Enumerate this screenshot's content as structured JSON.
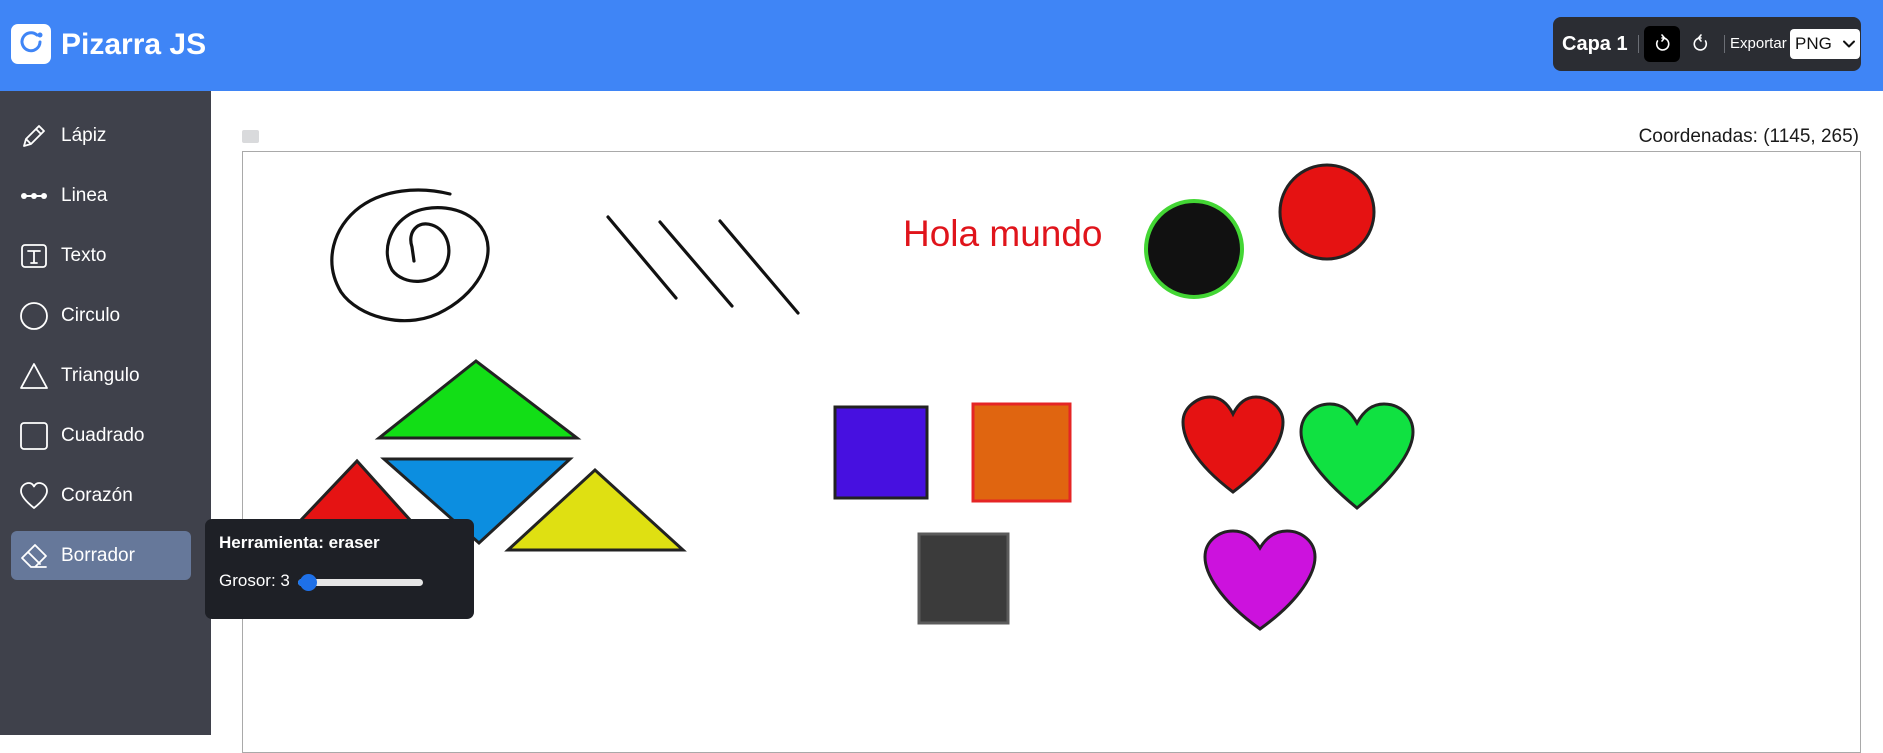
{
  "app": {
    "title": "Pizarra JS"
  },
  "toolbar": {
    "layer_label": "Capa 1",
    "undo_icon": "undo-icon",
    "redo_icon": "redo-icon",
    "export_label": "Exportar",
    "export_format": "PNG"
  },
  "sidebar": {
    "items": [
      {
        "label": "Lápiz",
        "icon": "pencil-icon"
      },
      {
        "label": "Linea",
        "icon": "line-icon"
      },
      {
        "label": "Texto",
        "icon": "text-icon"
      },
      {
        "label": "Circulo",
        "icon": "circle-icon"
      },
      {
        "label": "Triangulo",
        "icon": "triangle-icon"
      },
      {
        "label": "Cuadrado",
        "icon": "square-icon"
      },
      {
        "label": "Corazón",
        "icon": "heart-icon"
      },
      {
        "label": "Borrador",
        "icon": "eraser-icon",
        "active": true
      }
    ]
  },
  "canvas": {
    "coordinates": "Coordenadas: (1145, 265)",
    "text_item": "Hola mundo",
    "colors": {
      "text": "#e0141b",
      "circle_black_fill": "#111111",
      "circle_black_stroke": "#43d634",
      "circle_red_fill": "#e51212",
      "triangle_green": "#12de16",
      "triangle_red": "#e51313",
      "triangle_blue": "#0c8ee0",
      "triangle_yellow": "#dfe012",
      "square_purple": "#4710e0",
      "square_orange": "#e06510",
      "square_orange_stroke": "#e52525",
      "square_gray": "#3b3b3b",
      "heart_red": "#e51212",
      "heart_green": "#10e141",
      "heart_magenta": "#cc12dd"
    }
  },
  "popup": {
    "title": "Herramienta: eraser",
    "thickness_label": "Grosor: 3",
    "thickness_value": 3,
    "thickness_fraction": 0.02
  },
  "theme": {
    "header": "#3f85f6",
    "sidebar": "#3f414b",
    "active_tool": "#66789a",
    "toolbar": "#2b2d33"
  }
}
